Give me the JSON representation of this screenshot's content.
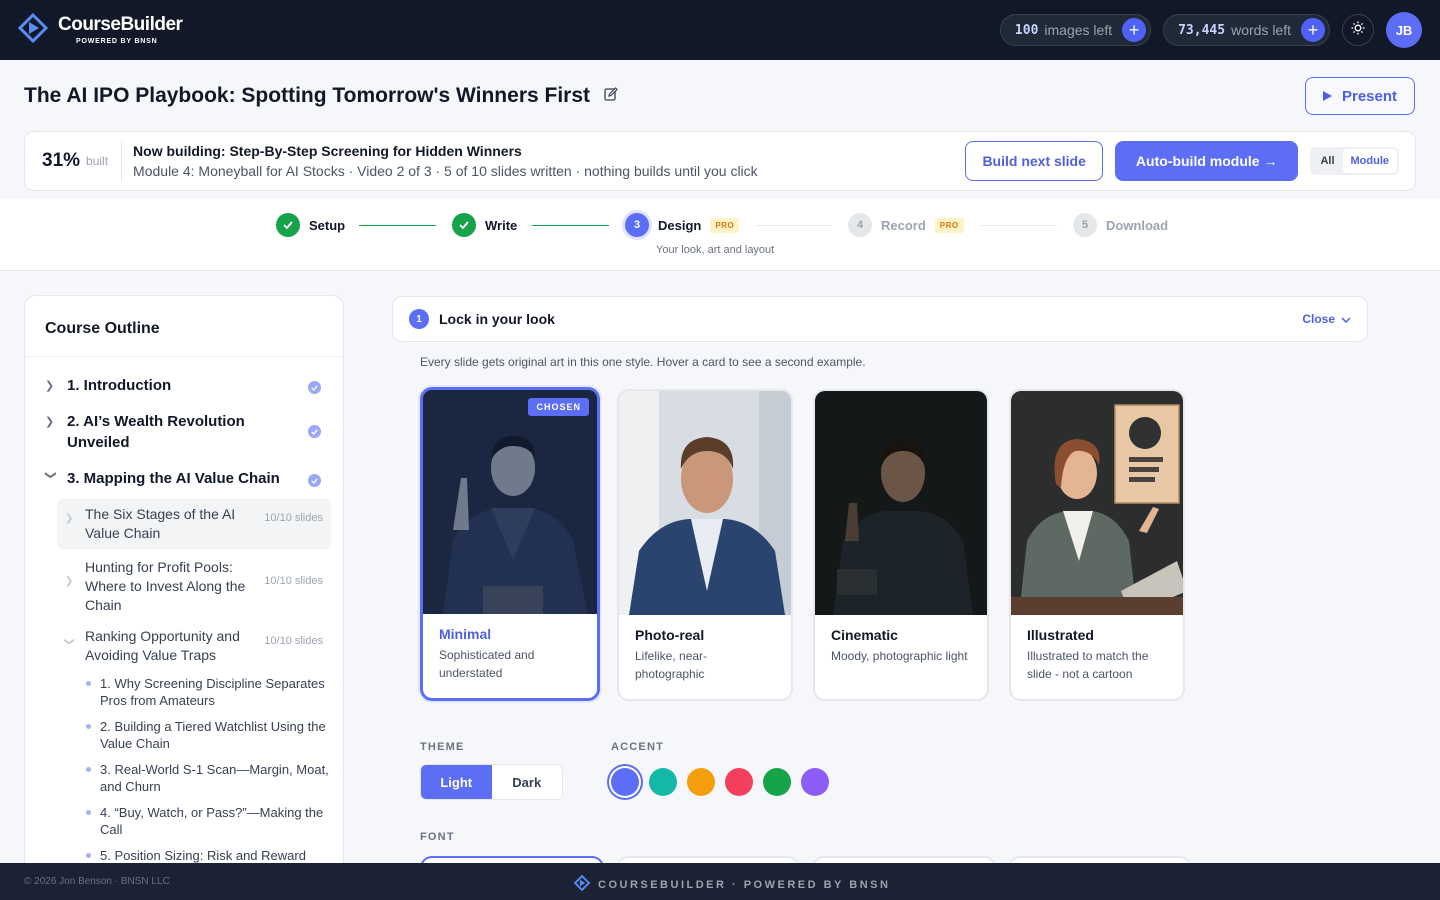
{
  "app": {
    "name": "CourseBuilder",
    "tagline": "POWERED BY BNSN"
  },
  "header": {
    "images_count": "100",
    "images_label": "images left",
    "words_count": "73,445",
    "words_label": "words left",
    "avatar_initials": "JB"
  },
  "course": {
    "title": "The AI IPO Playbook: Spotting Tomorrow's Winners First",
    "present_label": "Present"
  },
  "build": {
    "percent": "31%",
    "percent_label": "built",
    "now_building": "Now building: Step-By-Step Screening for Hidden Winners",
    "details": "Module 4: Moneyball for AI Stocks · Video 2 of 3 · 5 of 10 slides written · nothing builds until you click",
    "next_slide_label": "Build next slide",
    "auto_build_label": "Auto-build module →",
    "scope_options": [
      "All",
      "Module"
    ],
    "scope_selected": "Module"
  },
  "steps": [
    {
      "number": "1",
      "label": "Setup",
      "status": "done"
    },
    {
      "number": "2",
      "label": "Write",
      "status": "done"
    },
    {
      "number": "3",
      "label": "Design",
      "status": "active",
      "badge": "PRO",
      "caption": "Your look, art and layout"
    },
    {
      "number": "4",
      "label": "Record",
      "status": "todo",
      "badge": "PRO"
    },
    {
      "number": "5",
      "label": "Download",
      "status": "todo"
    }
  ],
  "outline": {
    "title": "Course Outline",
    "modules": [
      {
        "label": "1. Introduction"
      },
      {
        "label": "2. AI’s Wealth Revolution Unveiled"
      },
      {
        "label": "3. Mapping the AI Value Chain"
      }
    ],
    "lessons": [
      {
        "label": "The Six Stages of the AI Value Chain",
        "count": "10/10 slides"
      },
      {
        "label": "Hunting for Profit Pools: Where to Invest Along the Chain",
        "count": "10/10 slides"
      },
      {
        "label": "Ranking Opportunity and Avoiding Value Traps",
        "count": "10/10 slides"
      }
    ],
    "slides": [
      "1. Why Screening Discipline Separates Pros from Amateurs",
      "2. Building a Tiered Watchlist Using the Value Chain",
      "3. Real-World S-1 Scan—Margin, Moat, and Churn",
      "4. “Buy, Watch, or Pass?”—Making the Call",
      "5. Position Sizing: Risk and Reward"
    ]
  },
  "look": {
    "step_number": "1",
    "title": "Lock in your look",
    "close_label": "Close",
    "hint": "Every slide gets original art in this one style. Hover a card to see a second example.",
    "chosen_badge": "CHOSEN",
    "styles": [
      {
        "name": "Minimal",
        "desc": "Sophisticated and understated"
      },
      {
        "name": "Photo-real",
        "desc": "Lifelike, near-photographic"
      },
      {
        "name": "Cinematic",
        "desc": "Moody, photographic light"
      },
      {
        "name": "Illustrated",
        "desc": "Illustrated to match the slide - not a cartoon"
      }
    ],
    "theme_label": "THEME",
    "theme_options": [
      "Light",
      "Dark"
    ],
    "theme_selected": "Light",
    "accent_label": "ACCENT",
    "accent_colors": [
      "#5b6ef5",
      "#14b8a6",
      "#f59e0b",
      "#f43f5e",
      "#16a34a",
      "#8b5cf6"
    ],
    "font_label": "FONT"
  },
  "footer": {
    "copyright": "© 2026 Jon Benson · BNSN LLC",
    "brand": "COURSEBUILDER · POWERED BY BNSN"
  }
}
